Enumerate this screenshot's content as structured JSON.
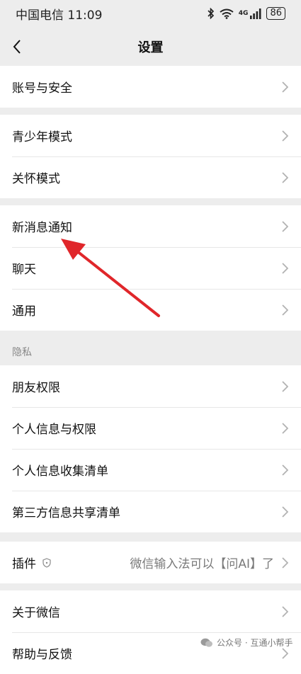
{
  "status_bar": {
    "carrier_time": "中国电信 11:09",
    "network": "4G",
    "battery": "86"
  },
  "header": {
    "title": "设置"
  },
  "groups": [
    {
      "items": [
        {
          "label": "账号与安全"
        }
      ]
    },
    {
      "items": [
        {
          "label": "青少年模式"
        },
        {
          "label": "关怀模式"
        }
      ]
    },
    {
      "items": [
        {
          "label": "新消息通知"
        },
        {
          "label": "聊天"
        },
        {
          "label": "通用"
        }
      ]
    },
    {
      "section_label": "隐私",
      "items": [
        {
          "label": "朋友权限"
        },
        {
          "label": "个人信息与权限"
        },
        {
          "label": "个人信息收集清单"
        },
        {
          "label": "第三方信息共享清单"
        }
      ]
    },
    {
      "items": [
        {
          "label": "插件",
          "value": "微信输入法可以【问AI】了"
        }
      ]
    },
    {
      "items": [
        {
          "label": "关于微信"
        },
        {
          "label": "帮助与反馈"
        }
      ]
    }
  ],
  "watermark": {
    "text": "公众号 · 互通小帮手"
  },
  "annotation": {
    "color": "#e0262a"
  },
  "icons": [
    "back-arrow-icon",
    "bluetooth-icon",
    "wifi-icon",
    "signal-icon",
    "chevron-right-icon",
    "shield-icon"
  ]
}
